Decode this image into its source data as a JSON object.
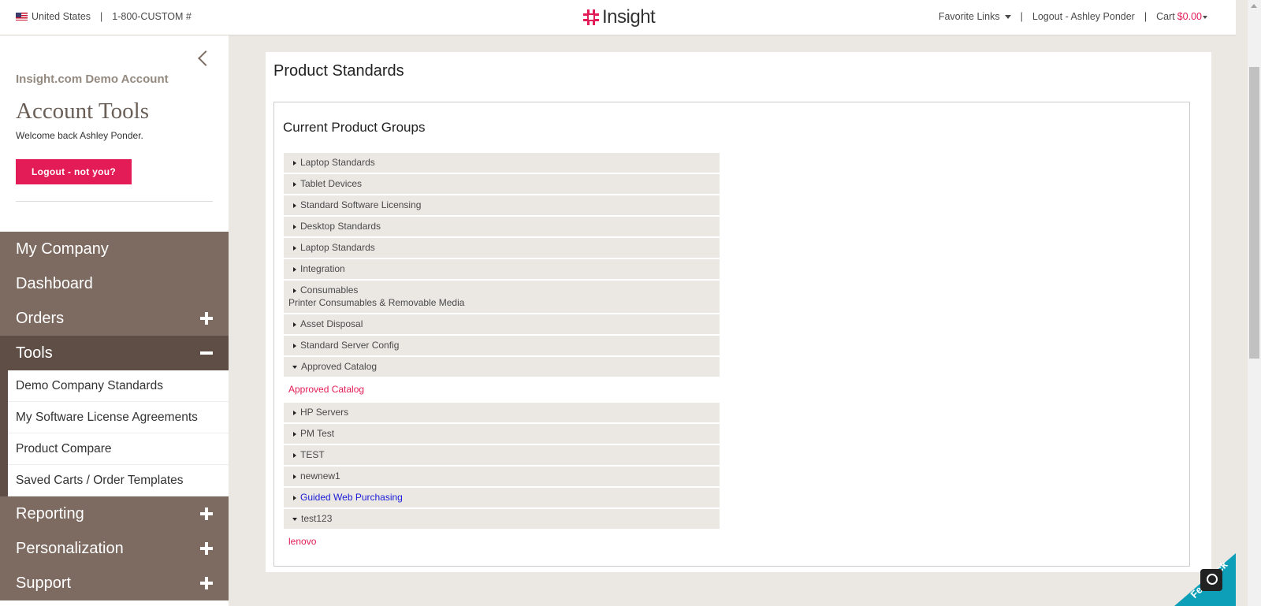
{
  "topbar": {
    "country": "United States",
    "phone": "1-800-CUSTOM #",
    "logo_text": "Insight",
    "favorite_links": "Favorite Links",
    "logout_user": "Logout - Ashley Ponder",
    "cart_label": "Cart",
    "cart_amount": "$0.00"
  },
  "sidebar": {
    "account_name": "Insight.com Demo Account",
    "title": "Account Tools",
    "welcome": "Welcome back Ashley Ponder.",
    "logout_button": "Logout - not you?",
    "nav": [
      {
        "label": "My Company"
      },
      {
        "label": "Dashboard"
      },
      {
        "label": "Orders"
      },
      {
        "label": "Tools"
      },
      {
        "label": "Reporting"
      },
      {
        "label": "Personalization"
      },
      {
        "label": "Support"
      }
    ],
    "tools_sub": [
      {
        "label": "Demo Company Standards"
      },
      {
        "label": "My Software License Agreements"
      },
      {
        "label": "Product Compare"
      },
      {
        "label": "Saved Carts / Order Templates"
      }
    ]
  },
  "main": {
    "page_title": "Product Standards",
    "groups_title": "Current Product Groups",
    "groups": [
      {
        "label": "Laptop Standards"
      },
      {
        "label": "Tablet Devices"
      },
      {
        "label": "Standard Software Licensing"
      },
      {
        "label": "Desktop Standards"
      },
      {
        "label": "Laptop Standards"
      },
      {
        "label": "Integration"
      },
      {
        "label": "Consumables",
        "sub": "Printer Consumables & Removable Media"
      },
      {
        "label": "Asset Disposal"
      },
      {
        "label": "Standard Server Config"
      },
      {
        "label": "Approved Catalog",
        "link": "Approved Catalog"
      },
      {
        "label": "HP Servers"
      },
      {
        "label": "PM Test"
      },
      {
        "label": "TEST"
      },
      {
        "label": "newnew1"
      },
      {
        "label": "Guided Web Purchasing"
      },
      {
        "label": "test123",
        "link": "lenovo"
      }
    ]
  },
  "feedback": {
    "label": "Feedback"
  },
  "colors": {
    "accent": "#e31b57",
    "nav_bg": "#7d6b61",
    "nav_active": "#5e4e45",
    "row_bg": "#ebe8e4"
  }
}
